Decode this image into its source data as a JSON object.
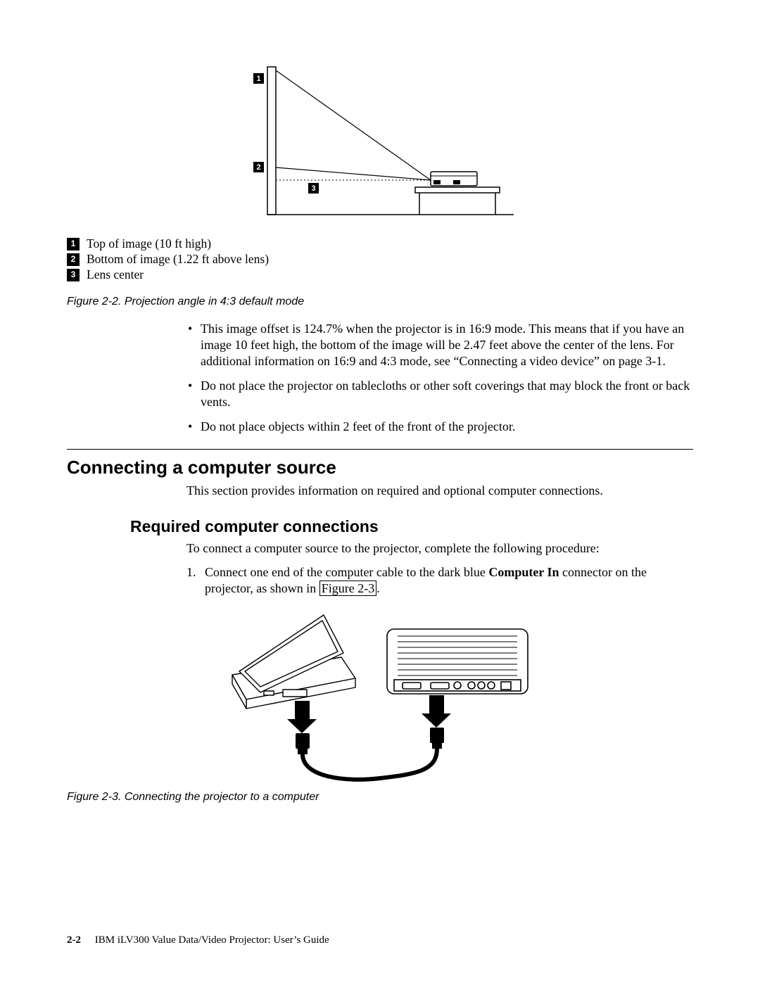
{
  "figure1": {
    "caption": "Figure 2-2. Projection angle in 4:3 default mode",
    "callouts": [
      {
        "num": "1",
        "text": "Top of image (10 ft high)"
      },
      {
        "num": "2",
        "text": "Bottom of image (1.22 ft above lens)"
      },
      {
        "num": "3",
        "text": "Lens center"
      }
    ]
  },
  "bullets": [
    "This image offset is 124.7% when the projector is in 16:9 mode. This means that if you have an image 10 feet high, the bottom of the image will be 2.47 feet above the center of the lens. For additional information on 16:9 and 4:3 mode, see “Connecting a video device” on page 3-1.",
    "Do not place the projector on tablecloths or other soft coverings that may block the front or back vents.",
    "Do not place objects within 2 feet of the front of the projector."
  ],
  "section": {
    "heading": "Connecting a computer source",
    "intro": "This section provides information on required and optional computer connections."
  },
  "subsection": {
    "heading": "Required computer connections",
    "intro": "To connect a computer source to the projector, complete the following procedure:",
    "step1_pre": "Connect one end of the computer cable to the dark blue ",
    "step1_bold": "Computer In",
    "step1_mid": " connector on the projector, as shown in ",
    "step1_link": "Figure 2-3",
    "step1_post": "."
  },
  "figure2": {
    "caption": "Figure 2-3. Connecting the projector to a computer"
  },
  "footer": {
    "page": "2-2",
    "title": "IBM iLV300 Value Data/Video Projector: User’s Guide"
  }
}
